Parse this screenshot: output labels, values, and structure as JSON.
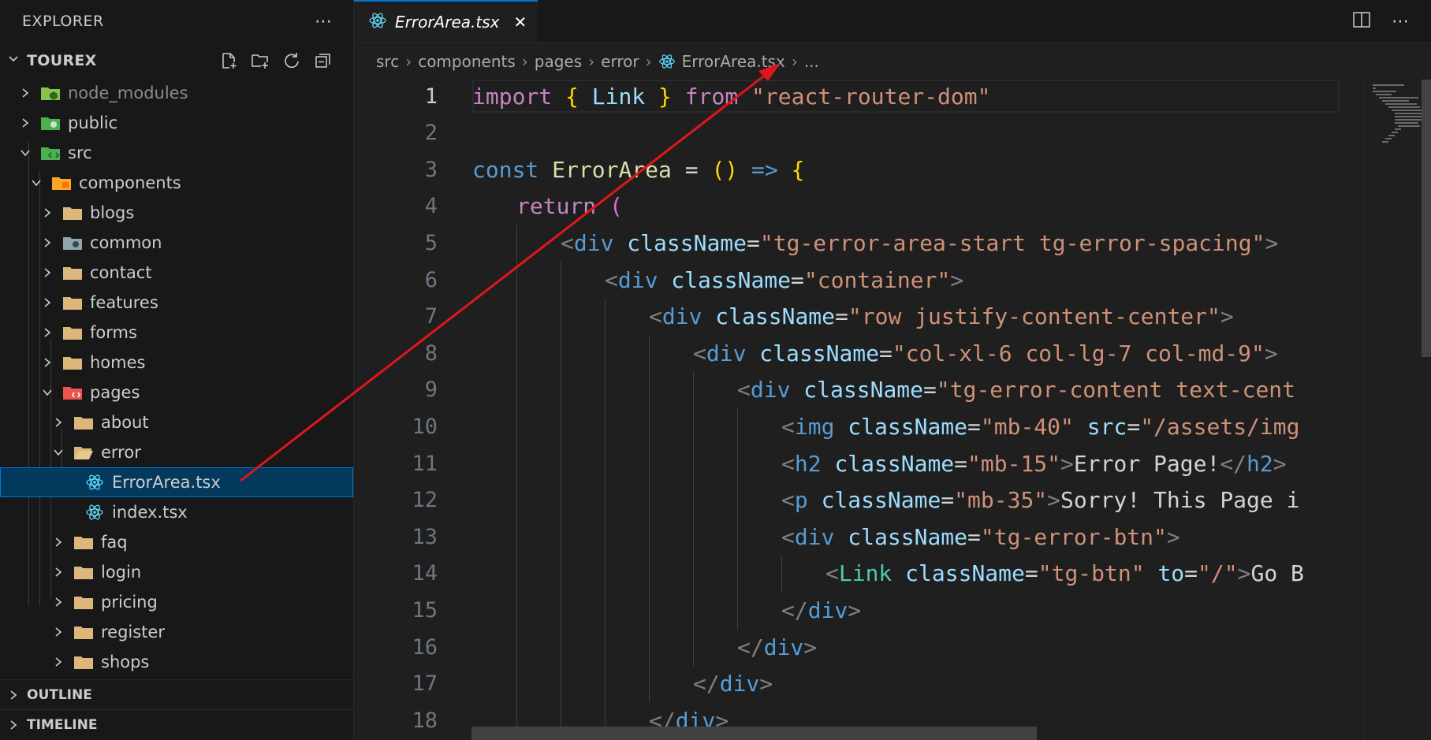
{
  "explorer": {
    "title": "EXPLORER",
    "more": "⋯",
    "root": "TOUREX"
  },
  "tree": [
    {
      "label": "node_modules"
    },
    {
      "label": "public"
    },
    {
      "label": "src"
    },
    {
      "label": "components"
    },
    {
      "label": "blogs"
    },
    {
      "label": "common"
    },
    {
      "label": "contact"
    },
    {
      "label": "features"
    },
    {
      "label": "forms"
    },
    {
      "label": "homes"
    },
    {
      "label": "pages"
    },
    {
      "label": "about"
    },
    {
      "label": "error"
    },
    {
      "label": "ErrorArea.tsx"
    },
    {
      "label": "index.tsx"
    },
    {
      "label": "faq"
    },
    {
      "label": "login"
    },
    {
      "label": "pricing"
    },
    {
      "label": "register"
    },
    {
      "label": "shops"
    }
  ],
  "sections": {
    "outline": "OUTLINE",
    "timeline": "TIMELINE"
  },
  "tab": {
    "label": "ErrorArea.tsx",
    "close": "✕"
  },
  "breadcrumb": [
    "src",
    "components",
    "pages",
    "error",
    "ErrorArea.tsx",
    "..."
  ],
  "line_numbers": [
    "1",
    "2",
    "3",
    "4",
    "5",
    "6",
    "7",
    "8",
    "9",
    "10",
    "11",
    "12",
    "13",
    "14",
    "15",
    "16",
    "17",
    "18"
  ],
  "code": {
    "l1": [
      "import",
      "{",
      "Link",
      "}",
      "from",
      "\"react-router-dom\""
    ],
    "l3": [
      "const",
      "ErrorArea",
      "=",
      "()",
      "=>",
      "{"
    ],
    "l4": [
      "return",
      "("
    ],
    "l5": [
      "<",
      "div",
      "className",
      "=",
      "\"tg-error-area-start tg-error-spacing\"",
      ">"
    ],
    "l6": [
      "<",
      "div",
      "className",
      "=",
      "\"container\"",
      ">"
    ],
    "l7": [
      "<",
      "div",
      "className",
      "=",
      "\"row justify-content-center\"",
      ">"
    ],
    "l8": [
      "<",
      "div",
      "className",
      "=",
      "\"col-xl-6 col-lg-7 col-md-9\"",
      ">"
    ],
    "l9": [
      "<",
      "div",
      "className",
      "=",
      "\"tg-error-content text-cent"
    ],
    "l10": [
      "<",
      "img",
      "className",
      "=",
      "\"mb-40\"",
      "src",
      "=",
      "\"/assets/img"
    ],
    "l11": [
      "<",
      "h2",
      "className",
      "=",
      "\"mb-15\"",
      ">",
      "Error Page!",
      "</",
      "h2",
      ">"
    ],
    "l12": [
      "<",
      "p",
      "className",
      "=",
      "\"mb-35\"",
      ">",
      "Sorry! This Page i"
    ],
    "l13": [
      "<",
      "div",
      "className",
      "=",
      "\"tg-error-btn\"",
      ">"
    ],
    "l14": [
      "<",
      "Link",
      "className",
      "=",
      "\"tg-btn\"",
      "to",
      "=",
      "\"/\"",
      ">",
      "Go B"
    ],
    "l15": [
      "</",
      "div",
      ">"
    ],
    "l16": [
      "</",
      "div",
      ">"
    ],
    "l17": [
      "</",
      "div",
      ">"
    ],
    "l18": [
      "</",
      "div",
      ">"
    ]
  },
  "colors": {
    "accent": "#0078d4",
    "selection": "#04395e",
    "annotation": "#e0161b",
    "folder": "#dcb67a",
    "react": "#61dafb"
  }
}
